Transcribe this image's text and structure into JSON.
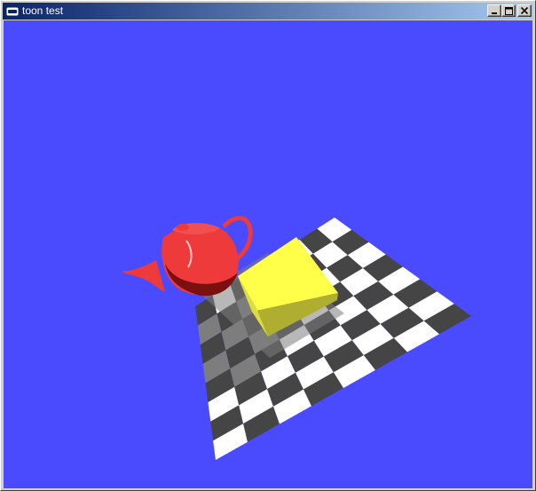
{
  "window": {
    "title": "toon test",
    "icon": "window-app-icon",
    "controls": [
      "minimize-icon",
      "maximize-icon",
      "close-icon"
    ]
  },
  "colors": {
    "background": "#4a4aff",
    "titlebar_start": "#0a246a",
    "titlebar_end": "#a6caf0",
    "teapot": "#ee3a3a",
    "teapot_shadow": "#7a1010",
    "cube_light": "#ffff4a",
    "cube_dark": "#b0ae30",
    "checker_dark": "#454545",
    "checker_light": "#ffffff",
    "checker_shadow": "#7d7d7d"
  }
}
